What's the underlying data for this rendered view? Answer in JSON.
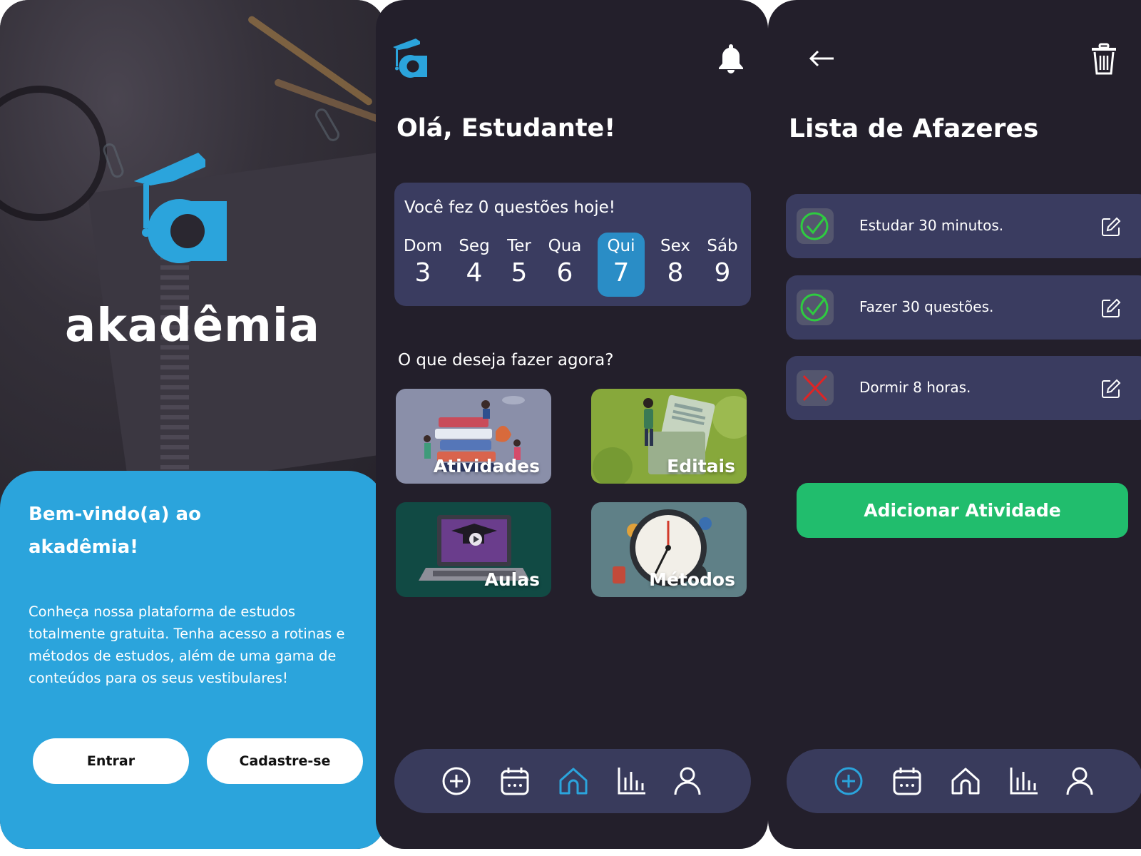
{
  "welcome": {
    "brand": "akadêmia",
    "title_line1": "Bem-vindo(a) ao",
    "title_line2": "akadêmia!",
    "body": "Conheça nossa plataforma de estudos totalmente gratuita. Tenha acesso a rotinas e métodos de estudos, além de uma gama de conteúdos para os seus vestibulares!",
    "login_label": "Entrar",
    "signup_label": "Cadastre-se"
  },
  "home": {
    "greeting": "Olá, Estudante!",
    "questions_today": "Você fez 0 questões hoje!",
    "days": [
      {
        "name": "Dom",
        "num": "3"
      },
      {
        "name": "Seg",
        "num": "4"
      },
      {
        "name": "Ter",
        "num": "5"
      },
      {
        "name": "Qua",
        "num": "6"
      },
      {
        "name": "Qui",
        "num": "7"
      },
      {
        "name": "Sex",
        "num": "8"
      },
      {
        "name": "Sáb",
        "num": "9"
      }
    ],
    "active_day": "Qui",
    "question": "O que deseja fazer agora?",
    "tiles": {
      "atividades": "Atividades",
      "editais": "Editais",
      "aulas": "Aulas",
      "metodos": "Métodos"
    },
    "nav_active": "home"
  },
  "todo": {
    "title": "Lista de Afazeres",
    "items": [
      {
        "text": "Estudar 30 minutos.",
        "status": "done"
      },
      {
        "text": "Fazer 30 questões.",
        "status": "done"
      },
      {
        "text": "Dormir 8 horas.",
        "status": "not-done"
      }
    ],
    "add_label": "Adicionar Atividade",
    "nav_active": "add"
  },
  "nav_icons": [
    "add-circle-icon",
    "calendar-icon",
    "home-icon",
    "chart-icon",
    "profile-icon"
  ],
  "colors": {
    "accent": "#2ba4dc",
    "dark_bg": "#231f2b",
    "card": "#3a3c60",
    "success": "#21bd6d",
    "check_green": "#2ecc40",
    "cross_red": "#e02424"
  }
}
